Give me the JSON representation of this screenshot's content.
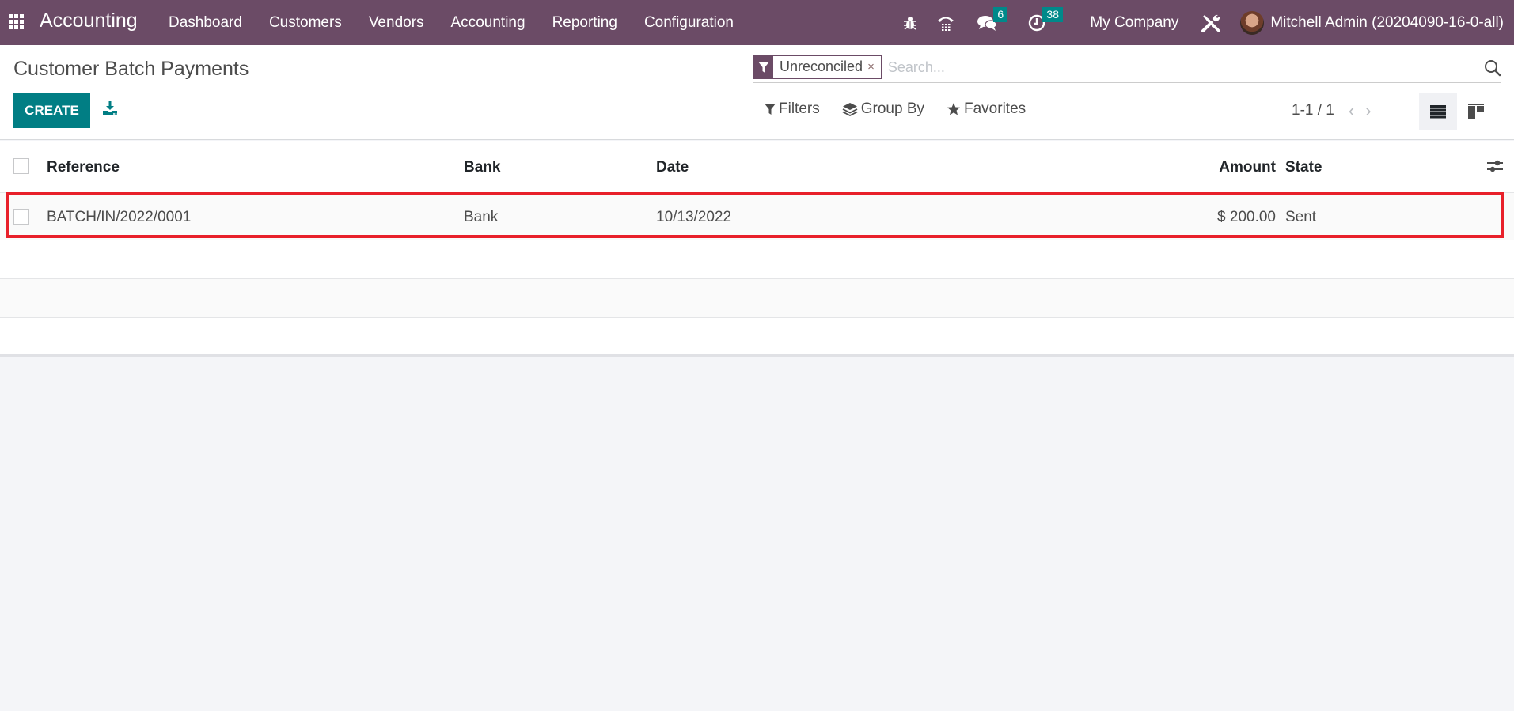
{
  "navbar": {
    "app_name": "Accounting",
    "menu": [
      "Dashboard",
      "Customers",
      "Vendors",
      "Accounting",
      "Reporting",
      "Configuration"
    ],
    "systray": {
      "debug_icon": "bug-icon",
      "phone_icon": "phone-icon",
      "messages_count": "6",
      "activities_count": "38",
      "company": "My Company",
      "settings_icon": "tools-icon",
      "user_name": "Mitchell Admin (20204090-16-0-all)"
    },
    "colors": {
      "bar": "#6b4b66",
      "badge": "#00898a"
    }
  },
  "control_panel": {
    "title": "Customer Batch Payments",
    "create_label": "CREATE",
    "download_icon": "download-icon",
    "search": {
      "facet_icon": "filter-icon",
      "facet_value": "Unreconciled",
      "facet_remove": "×",
      "placeholder": "Search..."
    },
    "filters_label": "Filters",
    "group_by_label": "Group By",
    "favorites_label": "Favorites",
    "pager": "1-1 / 1",
    "pager_prev": "‹",
    "pager_next": "›",
    "views": [
      "list",
      "kanban"
    ],
    "active_view": "list",
    "accent_color": "#017e84"
  },
  "table": {
    "columns": [
      "Reference",
      "Bank",
      "Date",
      "Amount",
      "State"
    ],
    "rows": [
      {
        "reference": "BATCH/IN/2022/0001",
        "bank": "Bank",
        "date": "10/13/2022",
        "amount": "$ 200.00",
        "state": "Sent"
      }
    ],
    "highlight_color": "#e8202a"
  }
}
